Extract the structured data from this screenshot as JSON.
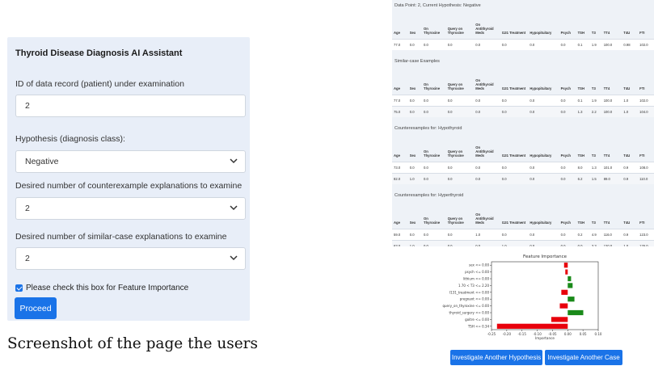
{
  "form": {
    "title": "Thyroid Disease Diagnosis AI Assistant",
    "id_label": "ID of data record (patient) under examination",
    "id_value": "2",
    "hypothesis_label": "Hypothesis (diagnosis class):",
    "hypothesis_value": "Negative",
    "counter_label": "Desired number of counterexample explanations to examine",
    "counter_value": "2",
    "similar_label": "Desired number of similar-case explanations to examine",
    "similar_value": "2",
    "checkbox_label": "Please check this box for Feature Importance",
    "proceed_label": "Proceed"
  },
  "caption": "Screenshot of the page the users",
  "columns": [
    "Age",
    "Sex",
    "On Thyroxine",
    "Query on Thyroxine",
    "On Antithyroid Meds",
    "I131 Treatment",
    "Hypopituitary",
    "Psych",
    "TSH",
    "T3",
    "TT4",
    "T4U",
    "FTI"
  ],
  "sections": [
    {
      "title": "Data Point: 2, Current Hypothesis: Negative",
      "rows": [
        [
          "77.0",
          "0.0",
          "0.0",
          "0.0",
          "0.0",
          "0.0",
          "0.0",
          "0.0",
          "0.1",
          "1.9",
          "100.0",
          "0.98",
          "102.0"
        ]
      ]
    },
    {
      "title": "Similar-case Examples",
      "rows": [
        [
          "77.0",
          "0.0",
          "0.0",
          "0.0",
          "0.0",
          "0.0",
          "0.0",
          "0.0",
          "0.1",
          "1.9",
          "100.0",
          "1.0",
          "102.0"
        ],
        [
          "75.0",
          "0.0",
          "0.0",
          "0.0",
          "0.0",
          "0.0",
          "0.0",
          "0.0",
          "1.3",
          "2.2",
          "100.0",
          "1.0",
          "104.0"
        ]
      ]
    },
    {
      "title": "Counterexamples for: Hypothyroid",
      "rows": [
        [
          "73.0",
          "0.0",
          "0.0",
          "0.0",
          "0.0",
          "0.0",
          "0.0",
          "0.0",
          "8.0",
          "1.3",
          "101.0",
          "0.9",
          "108.0"
        ],
        [
          "82.0",
          "1.0",
          "0.0",
          "0.0",
          "0.0",
          "0.0",
          "0.0",
          "0.0",
          "6.2",
          "1.5",
          "89.0",
          "0.9",
          "110.0"
        ]
      ]
    },
    {
      "title": "Counterexamples for: Hyperthyroid",
      "rows": [
        [
          "59.0",
          "0.0",
          "0.0",
          "0.0",
          "1.0",
          "0.0",
          "0.0",
          "0.0",
          "0.2",
          "4.9",
          "116.0",
          "0.9",
          "123.0"
        ],
        [
          "63.0",
          "1.0",
          "0.0",
          "0.0",
          "0.0",
          "1.0",
          "0.0",
          "0.0",
          "0.0",
          "3.3",
          "120.0",
          "1.0",
          "125.0"
        ]
      ]
    }
  ],
  "buttons": {
    "another_hypothesis": "Investigate Another Hypothesis",
    "another_case": "Investigate Another Case"
  },
  "colors": {
    "accent": "#1a73e8",
    "negative": "#e8000b",
    "positive": "#1a8a1a"
  },
  "chart_data": {
    "type": "bar",
    "orientation": "horizontal",
    "title": "Feature Importance",
    "xlabel": "Importance",
    "categories": [
      "sex <= 0.00",
      "psych <= 0.00",
      "lithium <= 0.00",
      "1.70 < T3 <= 2.20",
      "I131_treatment <= 0.00",
      "pregnant <= 0.00",
      "query_on_thyroxine <= 0.00",
      "thyroid_surgery <= 0.00",
      "goitre <= 0.00",
      "TSH <= 0.34"
    ],
    "values": [
      -0.012,
      -0.008,
      0.011,
      0.016,
      -0.021,
      0.022,
      -0.026,
      0.051,
      -0.054,
      -0.232
    ],
    "xticks": [
      "-0.25",
      "-0.20",
      "-0.15",
      "-0.10",
      "-0.05",
      "0.00",
      "0.05",
      "0.10"
    ],
    "xlim": [
      -0.25,
      0.1
    ]
  }
}
